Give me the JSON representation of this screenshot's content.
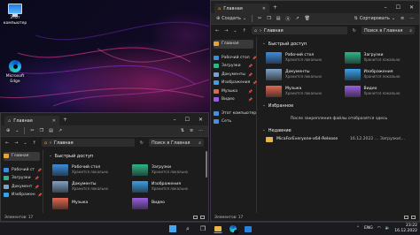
{
  "desktop": {
    "icons": [
      {
        "label": "Этот компьютер",
        "icon": "computer-icon"
      },
      {
        "label": "Microsoft Edge",
        "icon": "edge-icon"
      }
    ]
  },
  "win_right": {
    "tab_title": "Главная",
    "cmd": {
      "create": "Создать",
      "sort": "Сортировать"
    },
    "address": "Главная",
    "search_placeholder": "Поиск в Главная",
    "nav": [
      {
        "label": "Главная",
        "active": true,
        "color": "#e8a33b"
      },
      {
        "label": "Рабочий стол",
        "pin": true,
        "color": "#3b8de0"
      },
      {
        "label": "Загрузки",
        "pin": true,
        "color": "#2fb58a"
      },
      {
        "label": "Документы",
        "pin": true,
        "color": "#7fa3c8"
      },
      {
        "label": "Изображения",
        "pin": true,
        "color": "#3aa0e8"
      },
      {
        "label": "Музыка",
        "pin": true,
        "color": "#e0674f"
      },
      {
        "label": "Видео",
        "pin": true,
        "color": "#9a5de0"
      },
      {
        "label": "Этот компьютер",
        "color": "#4a8fdc"
      },
      {
        "label": "Сеть",
        "color": "#4a8fdc"
      }
    ],
    "quick_access_title": "Быстрый доступ",
    "quick_access": [
      {
        "name": "Рабочий стол",
        "sub": "Хранится локально",
        "color": "#3b8de0"
      },
      {
        "name": "Загрузки",
        "sub": "Хранится локально",
        "color": "#2fb58a"
      },
      {
        "name": "Документы",
        "sub": "Хранится локально",
        "color": "#7fa3c8"
      },
      {
        "name": "Изображения",
        "sub": "Хранится локально",
        "color": "#3aa0e8"
      },
      {
        "name": "Музыка",
        "sub": "Хранится локально",
        "color": "#e0674f"
      },
      {
        "name": "Видео",
        "sub": "Хранится локально",
        "color": "#9a5de0"
      }
    ],
    "favorites_title": "Избранное",
    "favorites_empty": "После закрепления файлы отобразятся здесь",
    "recent_title": "Недавние",
    "recent": [
      {
        "name": "MicaForEveryone-x64-Release",
        "date": "16.12.2022 ...",
        "path": "Загрузки\\..."
      }
    ],
    "status": "Элементов: 17"
  },
  "win_left": {
    "tab_title": "Главная",
    "address": "Главная",
    "search_placeholder": "Поиск в Главная",
    "nav": [
      {
        "label": "Главная",
        "active": true,
        "color": "#e8a33b"
      },
      {
        "label": "Рабочий ст",
        "pin": true,
        "color": "#3b8de0"
      },
      {
        "label": "Загрузки",
        "pin": true,
        "color": "#2fb58a"
      },
      {
        "label": "Документ",
        "pin": true,
        "color": "#7fa3c8"
      },
      {
        "label": "Изображен",
        "pin": true,
        "color": "#3aa0e8"
      }
    ],
    "quick_access_title": "Быстрый доступ",
    "quick_access": [
      {
        "name": "Рабочий стол",
        "sub": "Хранится локально",
        "color": "#3b8de0"
      },
      {
        "name": "Загрузки",
        "sub": "Хранится локально",
        "color": "#2fb58a"
      },
      {
        "name": "Документы",
        "sub": "Хранится локально",
        "color": "#7fa3c8"
      },
      {
        "name": "Изображения",
        "sub": "Хранится локально",
        "color": "#3aa0e8"
      },
      {
        "name": "Музыка",
        "sub": "",
        "color": "#e0674f"
      },
      {
        "name": "Видео",
        "sub": "",
        "color": "#9a5de0"
      }
    ],
    "status": "Элементов: 17"
  },
  "taskbar": {
    "lang": "ENG",
    "time": "23:22",
    "date": "16.12.2022"
  }
}
